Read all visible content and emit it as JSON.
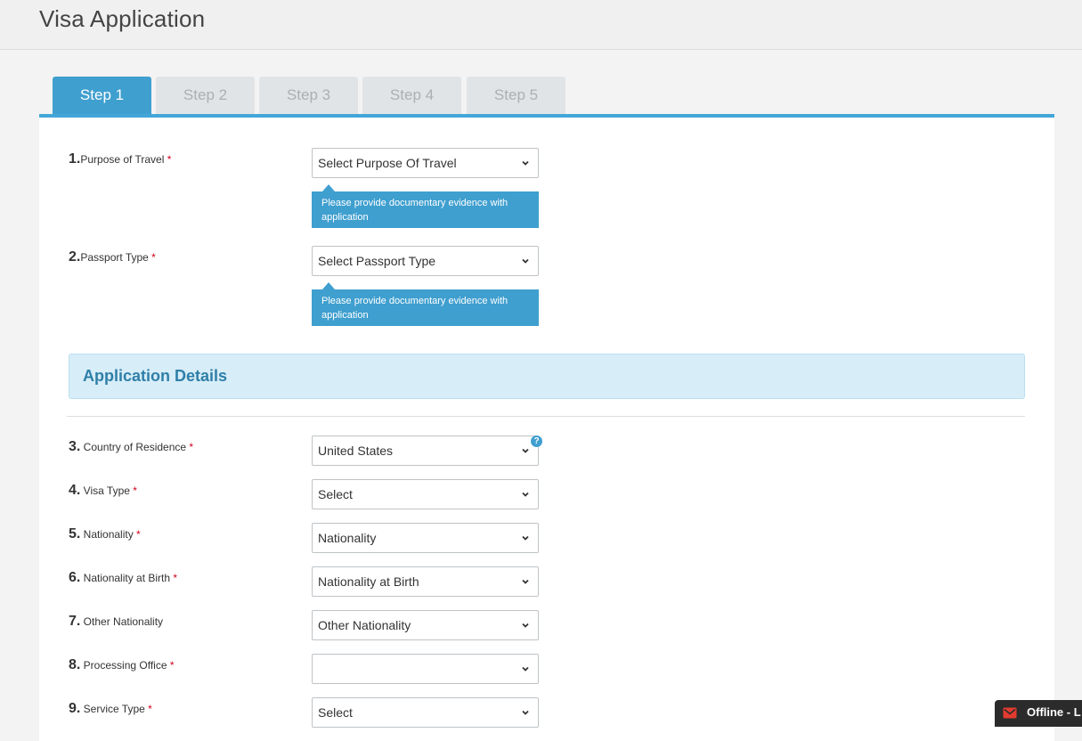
{
  "header": {
    "title": "Visa Application"
  },
  "tabs": [
    {
      "label": "Step 1",
      "active": true
    },
    {
      "label": "Step 2",
      "active": false
    },
    {
      "label": "Step 3",
      "active": false
    },
    {
      "label": "Step 4",
      "active": false
    },
    {
      "label": "Step 5",
      "active": false
    }
  ],
  "fields": [
    {
      "num": "1.",
      "label": "Purpose of Travel ",
      "required": "*",
      "value": "Select Purpose Of Travel",
      "hint": "Please provide documentary evidence with application"
    },
    {
      "num": "2.",
      "label": "Passport Type ",
      "required": "*",
      "value": "Select Passport Type",
      "hint": "Please provide documentary evidence with application"
    },
    {
      "num": "3.",
      "label": " Country of Residence ",
      "required": "*",
      "value": "United States",
      "help": "?"
    },
    {
      "num": "4.",
      "label": " Visa Type ",
      "required": "*",
      "value": "Select"
    },
    {
      "num": "5.",
      "label": " Nationality ",
      "required": "*",
      "value": "Nationality"
    },
    {
      "num": "6.",
      "label": " Nationality at Birth ",
      "required": "*",
      "value": "Nationality at Birth"
    },
    {
      "num": "7.",
      "label": " Other Nationality",
      "required": "",
      "value": "Other Nationality"
    },
    {
      "num": "8.",
      "label": " Processing Office ",
      "required": "*",
      "value": ""
    },
    {
      "num": "9.",
      "label": " Service Type ",
      "required": "*",
      "value": "Select"
    }
  ],
  "section": {
    "title": "Application Details"
  },
  "chat": {
    "label": "Offline - L",
    "icon": "mail-icon"
  },
  "colors": {
    "accent": "#3f9fcf",
    "required": "#d0021b",
    "section_bg": "#d7edf8"
  }
}
